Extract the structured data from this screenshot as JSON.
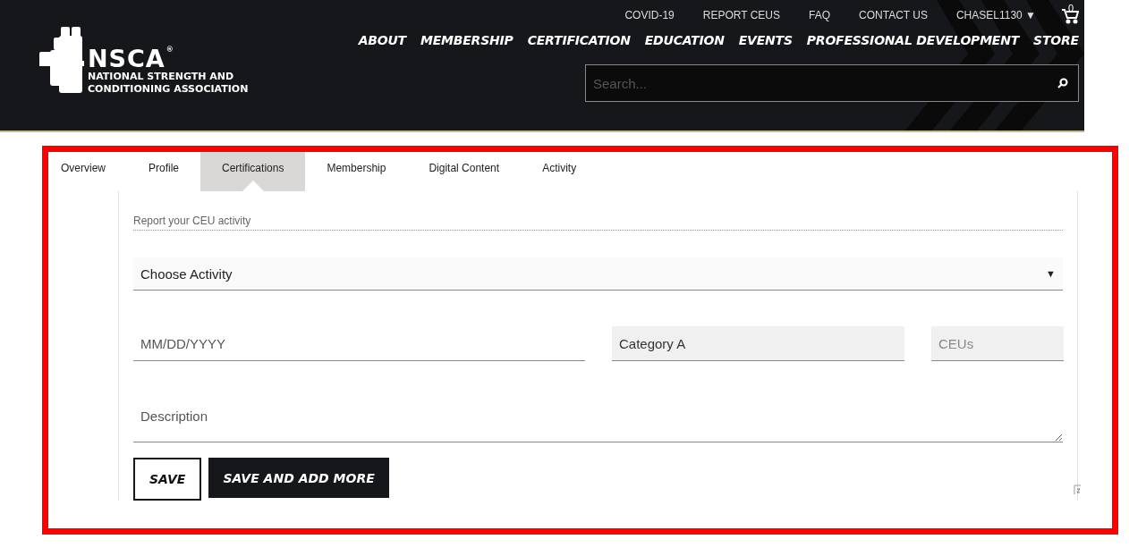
{
  "header": {
    "logo": {
      "acronym": "NSCA",
      "mark": "®",
      "line_1": "NATIONAL STRENGTH AND",
      "line_2": "CONDITIONING ASSOCIATION"
    },
    "top_links": [
      "COVID-19",
      "REPORT CEUS",
      "FAQ",
      "CONTACT US"
    ],
    "user_menu": {
      "label": "CHASEL1130",
      "caret": "▼"
    },
    "cart": {
      "count": "0"
    },
    "main_nav": [
      "ABOUT",
      "MEMBERSHIP",
      "CERTIFICATION",
      "EDUCATION",
      "EVENTS",
      "PROFESSIONAL DEVELOPMENT",
      "STORE"
    ],
    "search": {
      "placeholder": "Search..."
    }
  },
  "tabs": [
    {
      "label": "Overview",
      "selected": false
    },
    {
      "label": "Profile",
      "selected": false
    },
    {
      "label": "Certifications",
      "selected": true
    },
    {
      "label": "Membership",
      "selected": false
    },
    {
      "label": "Digital Content",
      "selected": false
    },
    {
      "label": "Activity",
      "selected": false
    }
  ],
  "form": {
    "section_label": "Report your CEU activity",
    "activity_select": {
      "value": "Choose Activity",
      "caret": "▼"
    },
    "date_field": {
      "placeholder": "MM/DD/YYYY",
      "disabled": false
    },
    "category_field": {
      "value": "Category A",
      "disabled": true
    },
    "ceus_field": {
      "placeholder": "CEUs",
      "disabled": true
    },
    "description_field": {
      "placeholder": "Description"
    },
    "buttons": [
      {
        "label": "SAVE",
        "kind": "outline"
      },
      {
        "label": "SAVE AND ADD MORE",
        "kind": "filled"
      }
    ]
  }
}
